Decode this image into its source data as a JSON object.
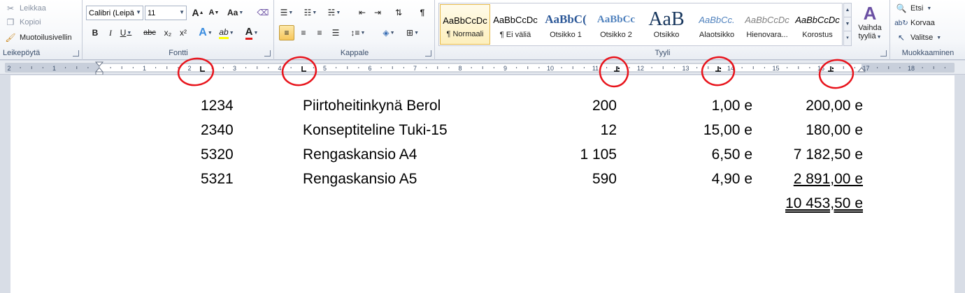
{
  "ribbon": {
    "clipboard": {
      "cut_label": "Leikkaa",
      "copy_label": "Kopioi",
      "format_painter_label": "Muotoilusivellin",
      "group_label": "Leikepöytä"
    },
    "font": {
      "font_name": "Calibri (Leipä",
      "font_size": "11",
      "grow_glyph": "A",
      "shrink_glyph": "A",
      "case_glyph": "Aa",
      "bold_glyph": "B",
      "italic_glyph": "I",
      "underline_glyph": "U",
      "strike_glyph": "abc",
      "subscript_glyph": "x₂",
      "superscript_glyph": "x²",
      "effects_glyph": "A",
      "highlight_glyph": "ab",
      "font_color_glyph": "A",
      "group_label": "Fontti"
    },
    "paragraph": {
      "pilcrow_glyph": "¶",
      "group_label": "Kappale"
    },
    "styles": {
      "tiles": [
        {
          "preview": "AaBbCcDc",
          "name": "¶ Normaali",
          "selected": true
        },
        {
          "preview": "AaBbCcDc",
          "name": "¶ Ei väliä",
          "selected": false
        },
        {
          "preview": "AaBbC(",
          "name": "Otsikko 1",
          "selected": false
        },
        {
          "preview": "AaBbCc",
          "name": "Otsikko 2",
          "selected": false
        },
        {
          "preview": "AaB",
          "name": "Otsikko",
          "selected": false
        },
        {
          "preview": "AaBbCc.",
          "name": "Alaotsikko",
          "selected": false
        },
        {
          "preview": "AaBbCcDc",
          "name": "Hienovara...",
          "selected": false
        },
        {
          "preview": "AaBbCcDc",
          "name": "Korostus",
          "selected": false
        }
      ],
      "change_styles_label_1": "Vaihda",
      "change_styles_label_2": "tyyliä",
      "change_styles_glyph": "A",
      "group_label": "Tyyli"
    },
    "editing": {
      "find_label": "Etsi",
      "replace_label": "Korvaa",
      "select_label": "Valitse",
      "group_label": "Muokkaaminen"
    }
  },
  "ruler": {
    "left_labels": [
      "2",
      "1"
    ],
    "labels": [
      "1",
      "2",
      "3",
      "4",
      "5",
      "6",
      "7",
      "8",
      "9",
      "10",
      "11",
      "12",
      "13",
      "14",
      "15",
      "16",
      "17",
      "18"
    ]
  },
  "document": {
    "rows": [
      {
        "code": "1234",
        "name": "Piirtoheitinkynä Berol",
        "qty": "200",
        "price": "1,00 e",
        "total": "200,00 e",
        "style": ""
      },
      {
        "code": "2340",
        "name": "Konseptiteline Tuki-15",
        "qty": "12",
        "price": "15,00 e",
        "total": "180,00 e",
        "style": ""
      },
      {
        "code": "5320",
        "name": "Rengaskansio A4",
        "qty": "1 105",
        "price": "6,50 e",
        "total": "7 182,50 e",
        "style": ""
      },
      {
        "code": "5321",
        "name": "Rengaskansio A5",
        "qty": "590",
        "price": "4,90 e",
        "total": "2 891,00 e",
        "style": "underline"
      }
    ],
    "grand_total": "10 453,50 e"
  },
  "colors": {
    "annotation": "#e8141c",
    "accent": "#2b5797",
    "selected_tile": "#fdefbd"
  }
}
